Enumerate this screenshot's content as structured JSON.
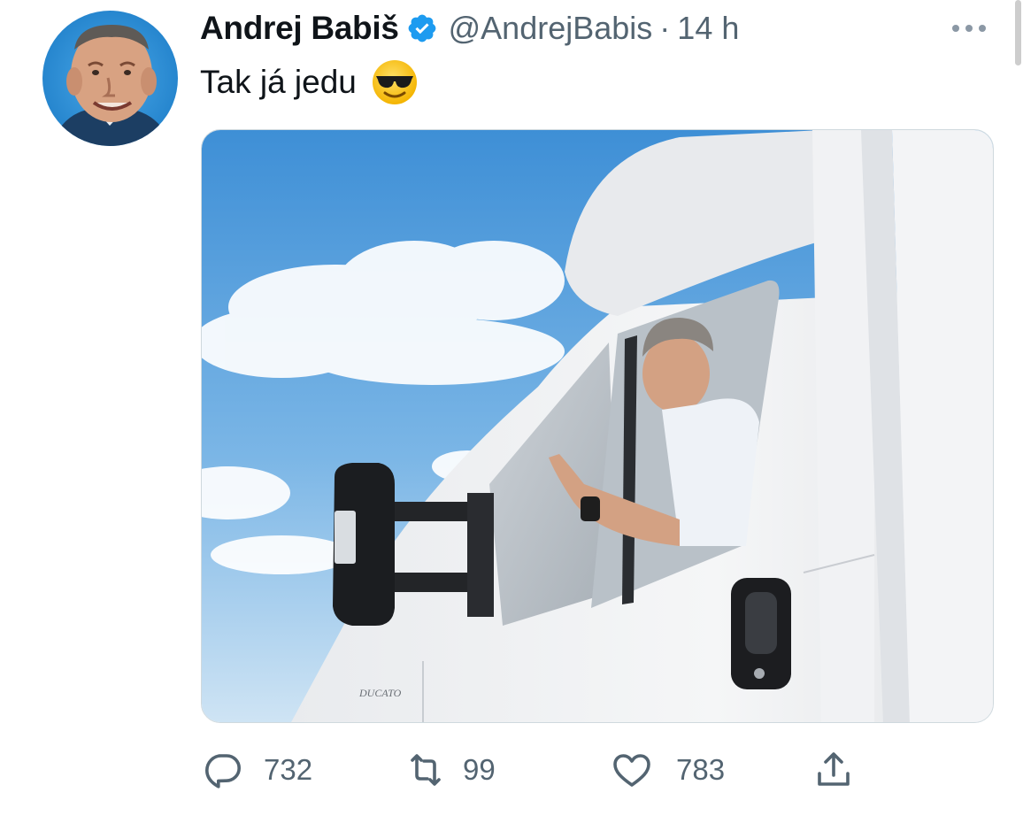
{
  "tweet": {
    "author": {
      "display_name": "Andrej Babiš",
      "handle": "@AndrejBabis",
      "verified": true,
      "avatar_icon": "profile-photo"
    },
    "separator": "·",
    "timestamp": "14 h",
    "text": "Tak já jedu",
    "emoji_icon": "smiling-face-with-sunglasses-icon",
    "media": {
      "type": "photo",
      "truck_badge_text": "DUCATO"
    }
  },
  "actions": {
    "reply": {
      "icon": "reply-icon",
      "count": "732"
    },
    "retweet": {
      "icon": "retweet-icon",
      "count": "99"
    },
    "like": {
      "icon": "heart-icon",
      "count": "783"
    },
    "share": {
      "icon": "share-icon"
    }
  },
  "colors": {
    "text_primary": "#0f1419",
    "text_secondary": "#536471",
    "verified_blue": "#1d9bf0",
    "border": "#cfd9de",
    "sky": "#5aa3dd"
  }
}
